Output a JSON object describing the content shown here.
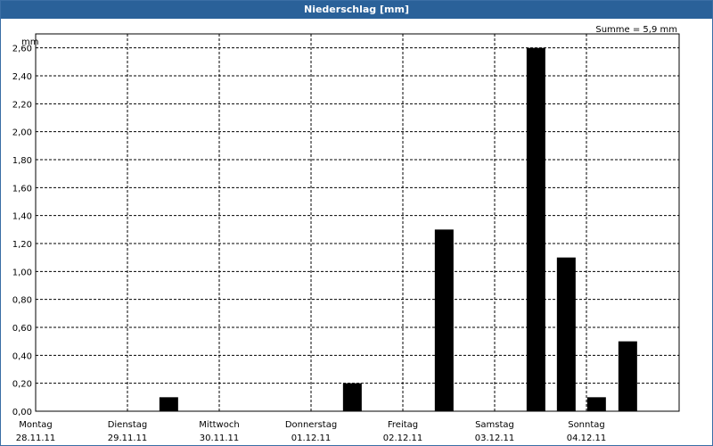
{
  "title": "Niederschlag [mm]",
  "chart_data": {
    "type": "bar",
    "title": "Niederschlag [mm]",
    "ylabel": "mm",
    "xlabel": "",
    "summary": "Summe = 5,9 mm",
    "ylim": [
      0,
      2.7
    ],
    "yticks": [
      "0,00",
      "0,20",
      "0,40",
      "0,60",
      "0,80",
      "1,00",
      "1,20",
      "1,40",
      "1,60",
      "1,80",
      "2,00",
      "2,20",
      "2,40",
      "2,60"
    ],
    "ytick_values": [
      0,
      0.2,
      0.4,
      0.6,
      0.8,
      1.0,
      1.2,
      1.4,
      1.6,
      1.8,
      2.0,
      2.2,
      2.4,
      2.6
    ],
    "days": [
      {
        "name": "Montag",
        "date": "28.11.11"
      },
      {
        "name": "Dienstag",
        "date": "29.11.11"
      },
      {
        "name": "Mittwoch",
        "date": "30.11.11"
      },
      {
        "name": "Donnerstag",
        "date": "01.12.11"
      },
      {
        "name": "Freitag",
        "date": "02.12.11"
      },
      {
        "name": "Samstag",
        "date": "03.12.11"
      },
      {
        "name": "Sonntag",
        "date": "04.12.11"
      }
    ],
    "bars": [
      {
        "day_position": 1.45,
        "value": 0.1
      },
      {
        "day_position": 3.45,
        "value": 0.2
      },
      {
        "day_position": 4.45,
        "value": 1.3
      },
      {
        "day_position": 5.45,
        "value": 2.6
      },
      {
        "day_position": 5.78,
        "value": 1.1
      },
      {
        "day_position": 6.11,
        "value": 0.1
      },
      {
        "day_position": 6.45,
        "value": 0.5
      }
    ],
    "grid": true,
    "bar_color": "#000000"
  }
}
